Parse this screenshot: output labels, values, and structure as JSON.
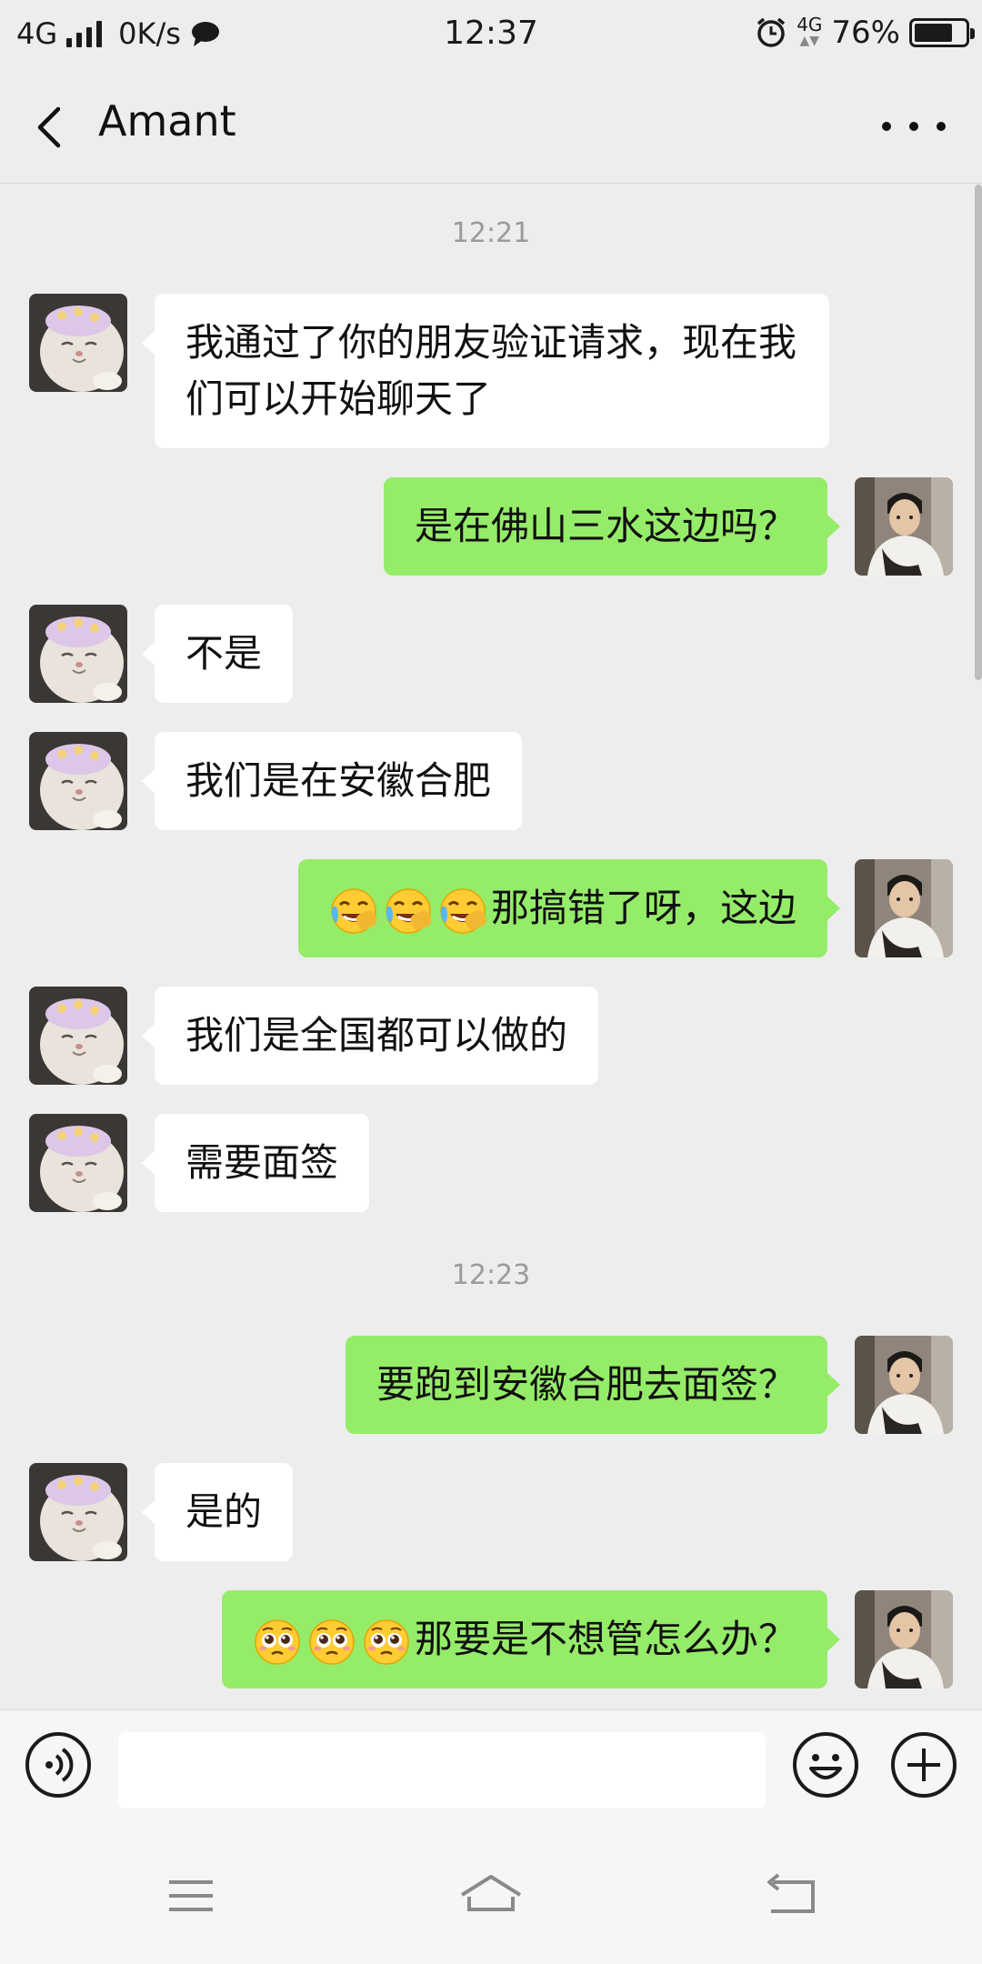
{
  "status_bar": {
    "network": "4G",
    "speed": "0K/s",
    "time": "12:37",
    "network_small": "4G",
    "battery_text": "76%",
    "battery_level": 0.76
  },
  "header": {
    "title": "Amant"
  },
  "messages": {
    "timestamp_1": "12:21",
    "m1": "我通过了你的朋友验证请求，现在我们可以开始聊天了",
    "m2": "是在佛山三水这边吗？",
    "m3": "不是",
    "m4": "我们是在安徽合肥",
    "m5": "那搞错了呀，这边",
    "m6": "我们是全国都可以做的",
    "m7": "需要面签",
    "timestamp_2": "12:23",
    "m8": "要跑到安徽合肥去面签？",
    "m9": "是的",
    "m10": "那要是不想管怎么办？"
  },
  "emojis": {
    "m5": [
      "laugh-cry-emoji",
      "laugh-cry-emoji",
      "laugh-cry-emoji"
    ],
    "m10": [
      "pleading-emoji",
      "pleading-emoji",
      "pleading-emoji"
    ]
  },
  "colors": {
    "background": "#ededed",
    "incoming_bubble": "#ffffff",
    "outgoing_bubble": "#95ec69",
    "timestamp": "#9b9b9b"
  },
  "input": {
    "value": "",
    "placeholder": ""
  }
}
